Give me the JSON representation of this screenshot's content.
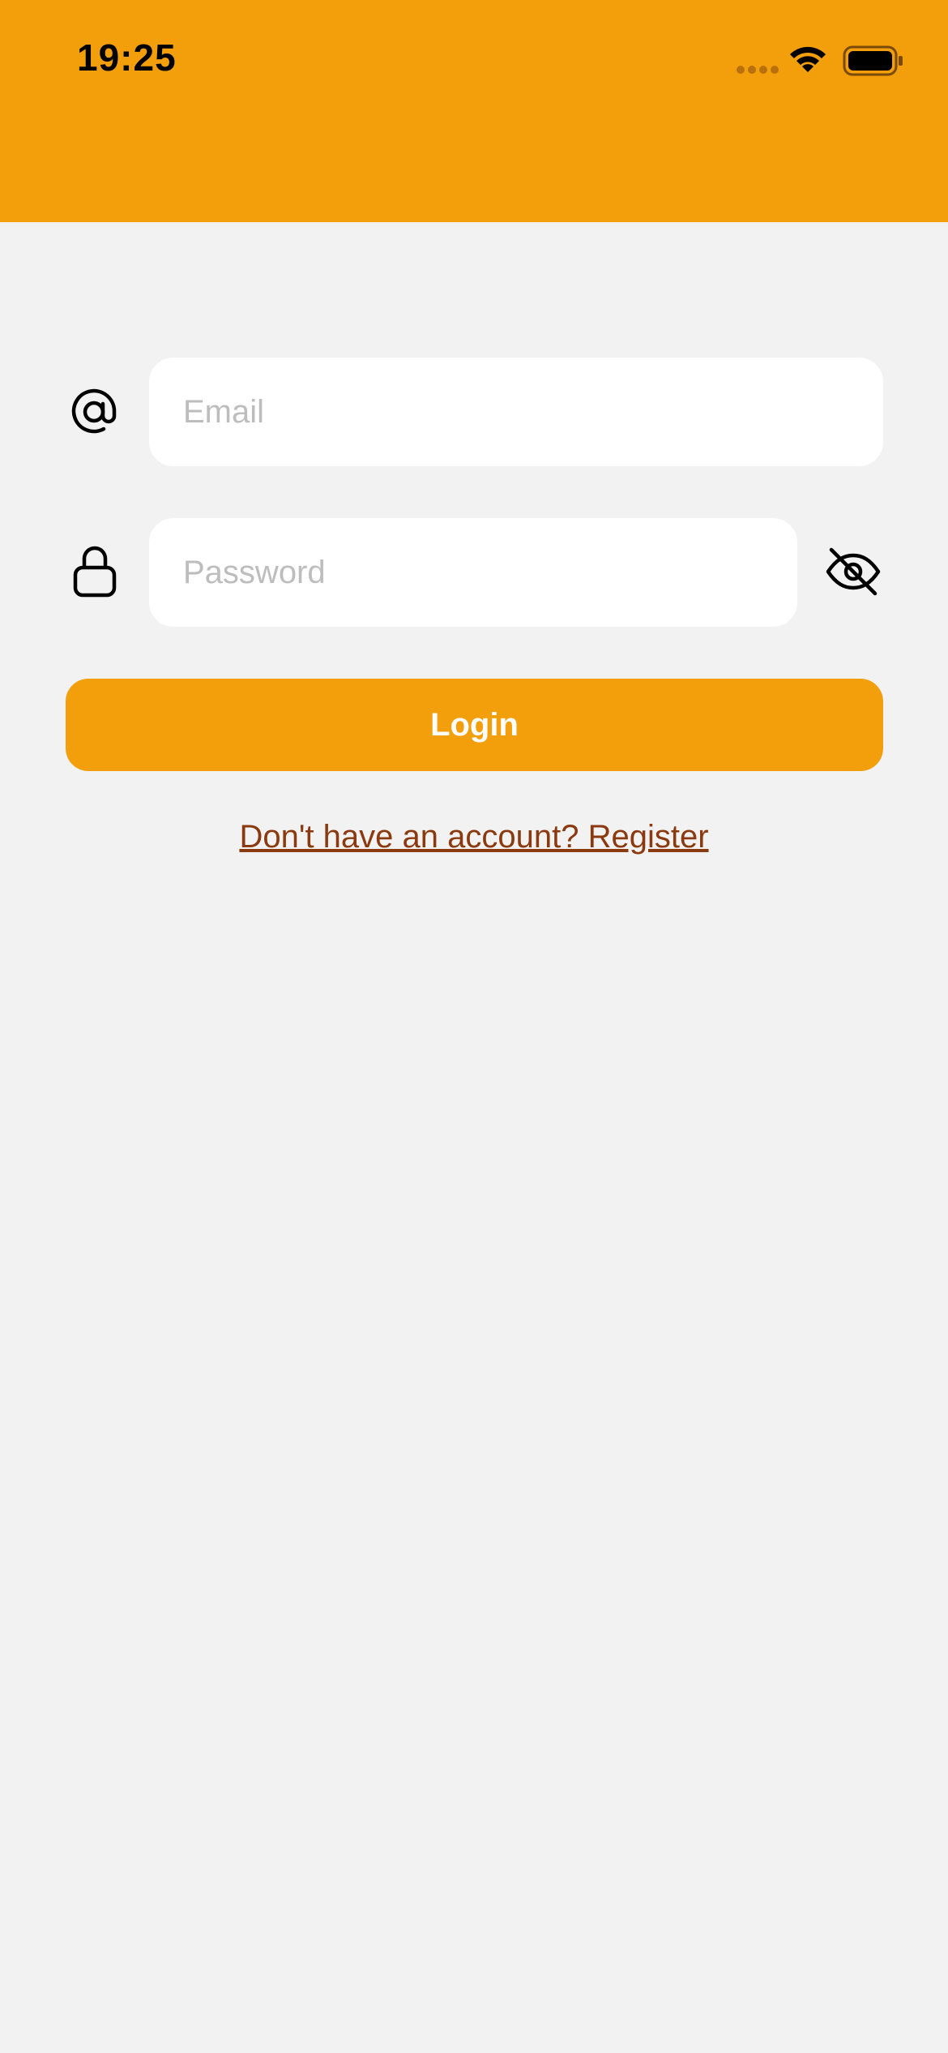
{
  "status_bar": {
    "time": "19:25",
    "icons": [
      "signal-icon",
      "wifi-icon",
      "battery-icon"
    ]
  },
  "colors": {
    "accent": "#f39f0c",
    "background": "#f2f2f2",
    "link": "#8b3a10",
    "placeholder": "#bdbdbd"
  },
  "form": {
    "email": {
      "icon": "at-icon",
      "placeholder": "Email",
      "value": ""
    },
    "password": {
      "icon": "lock-icon",
      "placeholder": "Password",
      "value": "",
      "visibility_toggle_icon": "eye-off-icon"
    },
    "login_label": "Login",
    "register_link": "Don't have an account? Register"
  }
}
